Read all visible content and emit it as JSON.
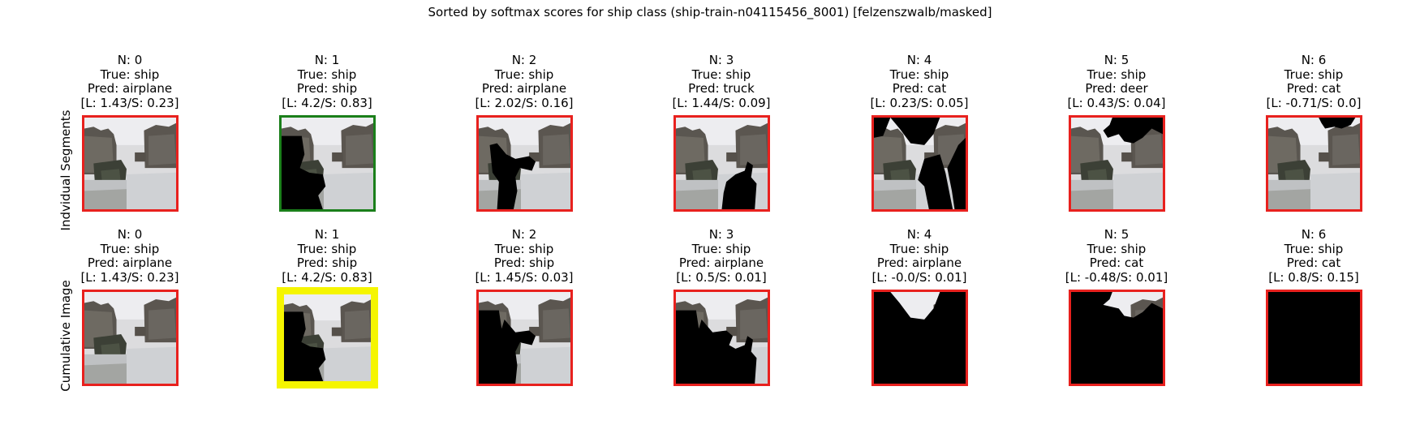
{
  "title": "Sorted by softmax scores for ship class (ship-train-n04115456_8001) [felzenszwalb/masked]",
  "row_labels": [
    "Indvidual Segments",
    "Cumulative Image"
  ],
  "colors": {
    "mispredicted": "#e8211e",
    "correct": "#1a7f1a",
    "best": "#f5f500"
  },
  "rows": [
    {
      "cells": [
        {
          "n": "N: 0",
          "true": "True: ship",
          "pred": "Pred: airplane",
          "score": "[L: 1.43/S: 0.23]",
          "frame": "red",
          "mask": "none"
        },
        {
          "n": "N: 1",
          "true": "True: ship",
          "pred": "Pred: ship",
          "score": "[L: 4.2/S: 0.83]",
          "frame": "green",
          "mask": "left"
        },
        {
          "n": "N: 2",
          "true": "True: ship",
          "pred": "Pred: airplane",
          "score": "[L: 2.02/S: 0.16]",
          "frame": "red",
          "mask": "mid-left"
        },
        {
          "n": "N: 3",
          "true": "True: ship",
          "pred": "Pred: truck",
          "score": "[L: 1.44/S: 0.09]",
          "frame": "red",
          "mask": "bottom-right"
        },
        {
          "n": "N: 4",
          "true": "True: ship",
          "pred": "Pred: cat",
          "score": "[L: 0.23/S: 0.05]",
          "frame": "red",
          "mask": "outer"
        },
        {
          "n": "N: 5",
          "true": "True: ship",
          "pred": "Pred: deer",
          "score": "[L: 0.43/S: 0.04]",
          "frame": "red",
          "mask": "top-arc"
        },
        {
          "n": "N: 6",
          "true": "True: ship",
          "pred": "Pred: cat",
          "score": "[L: -0.71/S: 0.0]",
          "frame": "red",
          "mask": "top-small"
        }
      ]
    },
    {
      "cells": [
        {
          "n": "N: 0",
          "true": "True: ship",
          "pred": "Pred: airplane",
          "score": "[L: 1.43/S: 0.23]",
          "frame": "red",
          "mask": "none"
        },
        {
          "n": "N: 1",
          "true": "True: ship",
          "pred": "Pred: ship",
          "score": "[L: 4.2/S: 0.83]",
          "frame": "yellow",
          "mask": "left"
        },
        {
          "n": "N: 2",
          "true": "True: ship",
          "pred": "Pred: ship",
          "score": "[L: 1.45/S: 0.03]",
          "frame": "red",
          "mask": "cum2"
        },
        {
          "n": "N: 3",
          "true": "True: ship",
          "pred": "Pred: airplane",
          "score": "[L: 0.5/S: 0.01]",
          "frame": "red",
          "mask": "cum3"
        },
        {
          "n": "N: 4",
          "true": "True: ship",
          "pred": "Pred: airplane",
          "score": "[L: -0.0/S: 0.01]",
          "frame": "red",
          "mask": "cum4"
        },
        {
          "n": "N: 5",
          "true": "True: ship",
          "pred": "Pred: cat",
          "score": "[L: -0.48/S: 0.01]",
          "frame": "red",
          "mask": "cum5"
        },
        {
          "n": "N: 6",
          "true": "True: ship",
          "pred": "Pred: cat",
          "score": "[L: 0.8/S: 0.15]",
          "frame": "red",
          "mask": "all"
        }
      ]
    }
  ]
}
